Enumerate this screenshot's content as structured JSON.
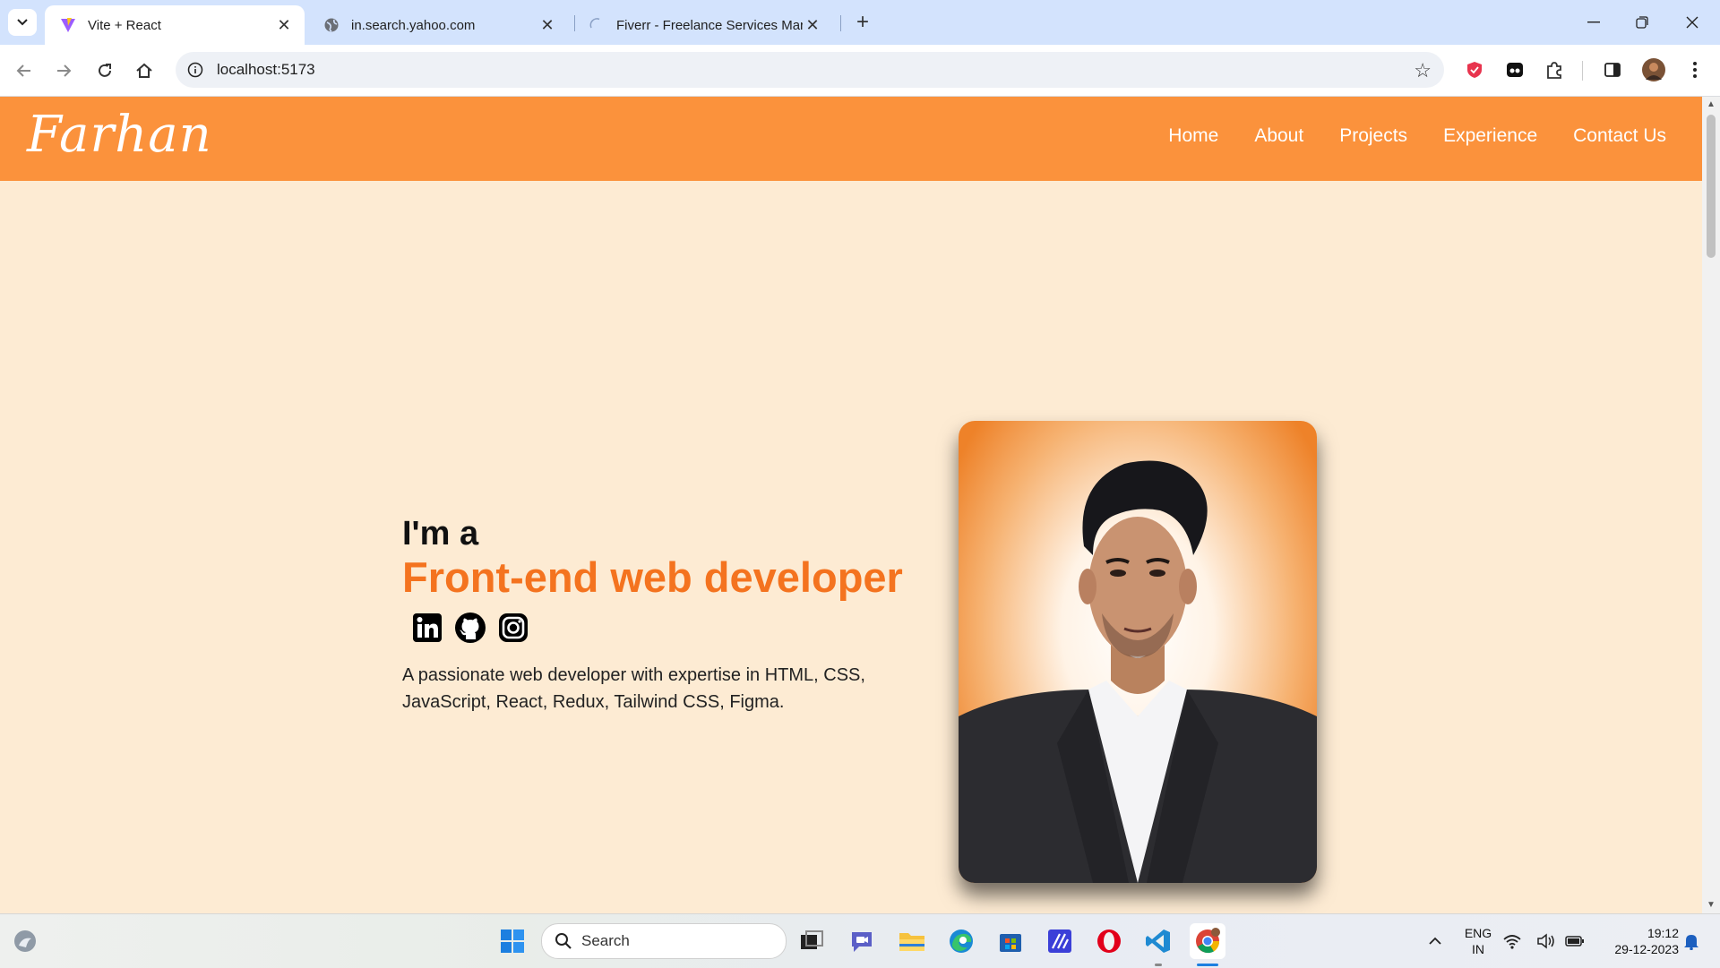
{
  "browser": {
    "tabs": [
      {
        "title": "Vite + React",
        "active": true
      },
      {
        "title": "in.search.yahoo.com",
        "active": false
      },
      {
        "title": "Fiverr - Freelance Services Mark",
        "active": false
      }
    ],
    "url": "localhost:5173"
  },
  "site": {
    "logo": "Farhan",
    "nav": [
      "Home",
      "About",
      "Projects",
      "Experience",
      "Contact Us"
    ],
    "hero": {
      "intro": "I'm a",
      "role": "Front-end web developer",
      "description": "A passionate web developer with expertise in HTML, CSS, JavaScript, React, Redux, Tailwind CSS, Figma."
    },
    "accent_color": "#fb923c",
    "role_color": "#f4731f",
    "background_color": "#fdebd3"
  },
  "taskbar": {
    "search_label": "Search",
    "language": "ENG",
    "region": "IN",
    "time": "19:12",
    "date": "29-12-2023"
  }
}
